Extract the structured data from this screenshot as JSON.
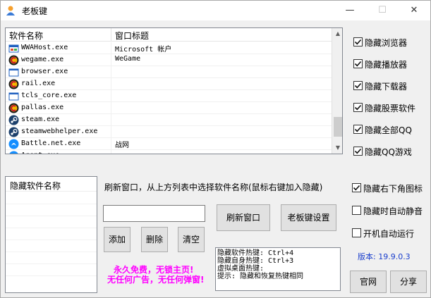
{
  "window": {
    "title": "老板键"
  },
  "titlebar": {
    "minimize": "—",
    "maximize": "☐",
    "close": "✕"
  },
  "process_list": {
    "columns": [
      "软件名称",
      "窗口标题"
    ],
    "rows": [
      {
        "name": "WWAHost.exe",
        "title": "Microsoft 帐户",
        "icon": "windows-app-icon"
      },
      {
        "name": "wegame.exe",
        "title": "WeGame",
        "icon": "wegame-icon"
      },
      {
        "name": "browser.exe",
        "title": "",
        "icon": "window-icon"
      },
      {
        "name": "rail.exe",
        "title": "",
        "icon": "wegame-icon"
      },
      {
        "name": "tcls_core.exe",
        "title": "",
        "icon": "window-icon"
      },
      {
        "name": "pallas.exe",
        "title": "",
        "icon": "wegame-icon"
      },
      {
        "name": "steam.exe",
        "title": "",
        "icon": "steam-icon"
      },
      {
        "name": "steamwebhelper.exe",
        "title": "",
        "icon": "steam-icon"
      },
      {
        "name": "Battle.net.exe",
        "title": "战网",
        "icon": "battlenet-icon"
      },
      {
        "name": "Agent.exe",
        "title": "",
        "icon": "battlenet-icon"
      }
    ]
  },
  "options_top": [
    {
      "label": "隐藏浏览器",
      "checked": true
    },
    {
      "label": "隐藏播放器",
      "checked": true
    },
    {
      "label": "隐藏下载器",
      "checked": true
    },
    {
      "label": "隐藏股票软件",
      "checked": true
    },
    {
      "label": "隐藏全部QQ",
      "checked": true
    },
    {
      "label": "隐藏QQ游戏",
      "checked": true
    }
  ],
  "options_bottom": [
    {
      "label": "隐藏右下角图标",
      "checked": true
    },
    {
      "label": "隐藏时自动静音",
      "checked": false
    },
    {
      "label": "开机自动运行",
      "checked": false
    }
  ],
  "hidden_list": {
    "header": "隐藏软件名称"
  },
  "hint": "刷新窗口，从上方列表中选择软件名称(鼠标右键加入隐藏)",
  "input": {
    "value": ""
  },
  "buttons": {
    "add": "添加",
    "delete": "删除",
    "clear": "清空",
    "refresh": "刷新窗口",
    "settings": "老板键设置",
    "website": "官网",
    "share": "分享"
  },
  "promo": {
    "line1": "永久免费，无锁主页!",
    "line2": "无任何广告，无任何弹窗!"
  },
  "hotkeys": [
    "隐藏软件热键: Ctrl+4",
    "隐藏自身热键: Ctrl+3",
    "虚拟桌面热键:",
    "提示: 隐藏和恢复热键相同"
  ],
  "version": "版本: 19.9.0.3",
  "colors": {
    "promo": "#ff00ff",
    "version": "#1a3ecc"
  }
}
